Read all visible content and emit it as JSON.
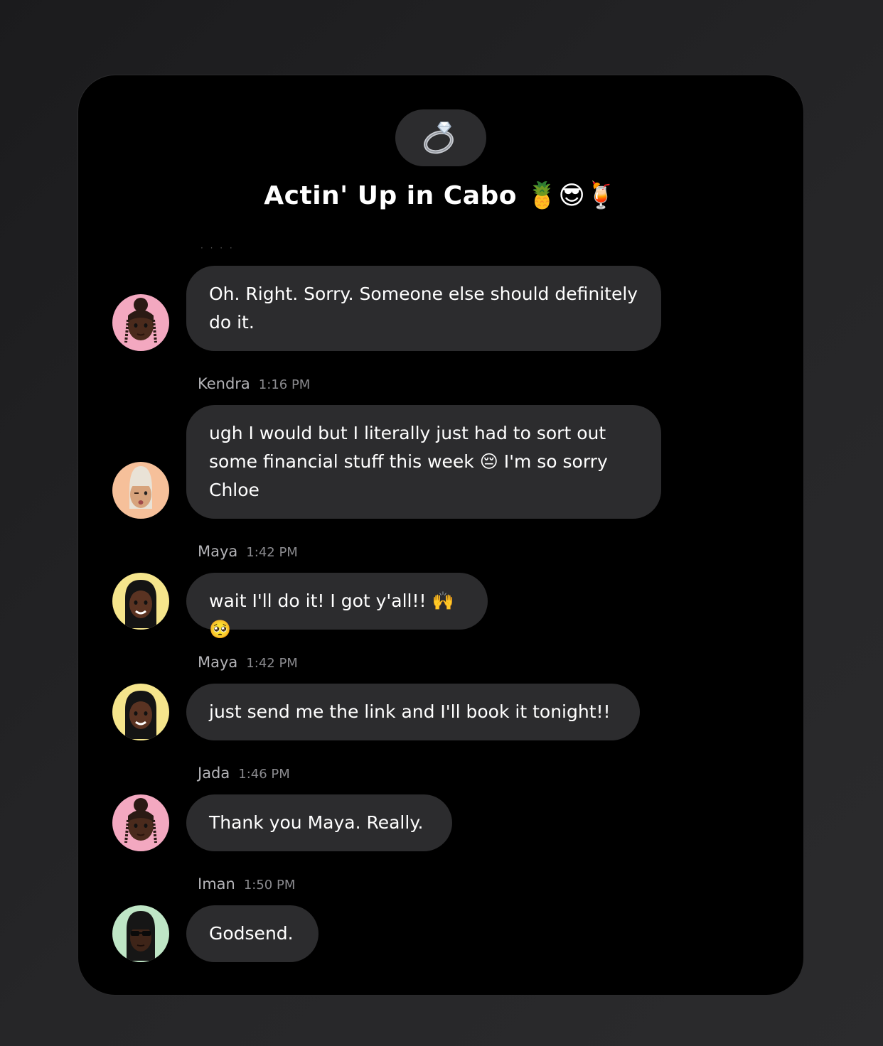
{
  "conversation": {
    "icon": "ring-icon",
    "title": "Actin' Up in Cabo 🍍😎🍹"
  },
  "messages": [
    {
      "avatar": "memoji-bun-braids",
      "avatar_bg": "#f3a8c0",
      "text": "Oh. Right. Sorry. Someone else should definitely do it."
    },
    {
      "sender": "Kendra",
      "time": "1:16 PM",
      "avatar": "memoji-blonde-wink",
      "avatar_bg": "#f6c09a",
      "text": "ugh I would but I literally just had to sort out some financial stuff this week 😔 I'm so sorry Chloe"
    },
    {
      "sender": "Maya",
      "time": "1:42 PM",
      "avatar": "memoji-long-black-hair",
      "avatar_bg": "#f5e58c",
      "text": "wait I'll do it! I got y'all!! 🙌🥺"
    },
    {
      "sender": "Maya",
      "time": "1:42 PM",
      "avatar": "memoji-long-black-hair",
      "avatar_bg": "#f5e58c",
      "text": "just send me the link and I'll book it tonight!!"
    },
    {
      "sender": "Jada",
      "time": "1:46 PM",
      "avatar": "memoji-bun-braids",
      "avatar_bg": "#f3a8c0",
      "text": "Thank you Maya. Really."
    },
    {
      "sender": "Iman",
      "time": "1:50 PM",
      "avatar": "memoji-sunglasses-bangs",
      "avatar_bg": "#bfe6c6",
      "text": "Godsend."
    }
  ],
  "colors": {
    "card_bg": "#000000",
    "bubble_bg": "#2c2c2e",
    "meta_text": "#b4b4b8",
    "time_text": "#8a8a8e"
  }
}
